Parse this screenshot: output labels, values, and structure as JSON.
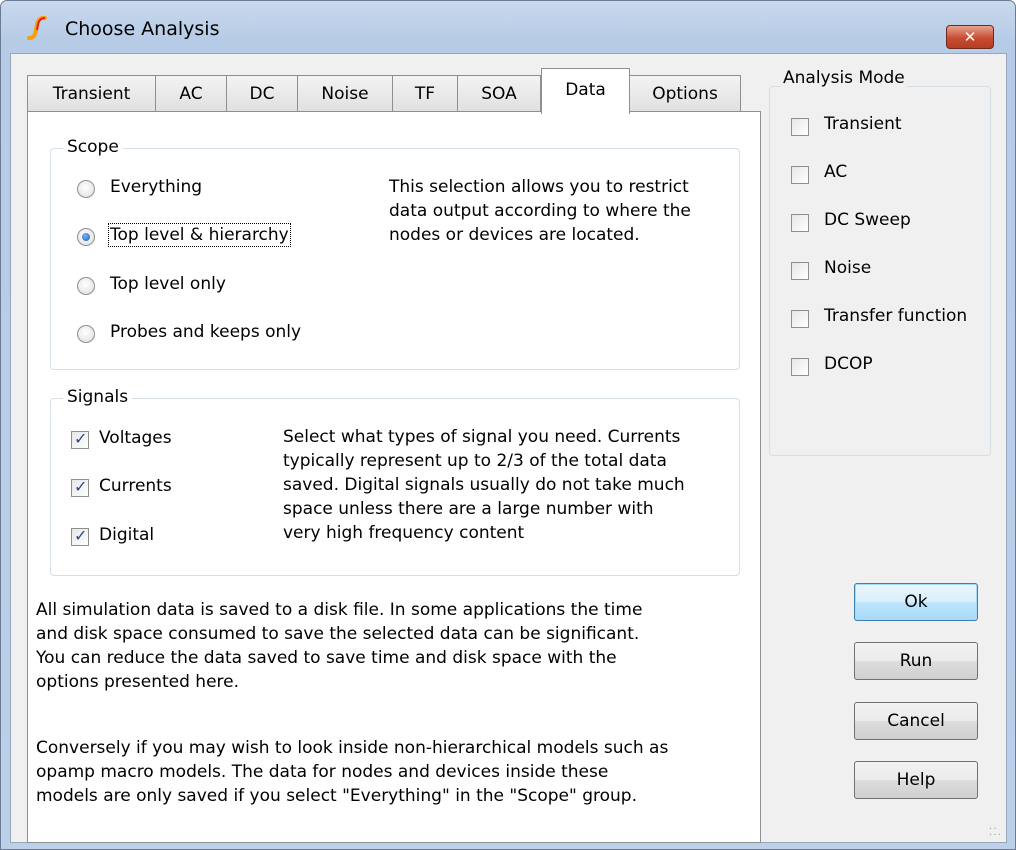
{
  "window": {
    "title": "Choose Analysis",
    "close_glyph": "✕",
    "icon": "simetrix-logo-icon"
  },
  "tabs": [
    {
      "label": "Transient",
      "active": false
    },
    {
      "label": "AC",
      "active": false
    },
    {
      "label": "DC",
      "active": false
    },
    {
      "label": "Noise",
      "active": false
    },
    {
      "label": "TF",
      "active": false
    },
    {
      "label": "SOA",
      "active": false
    },
    {
      "label": "Data",
      "active": true
    },
    {
      "label": "Options",
      "active": false
    }
  ],
  "scope": {
    "title": "Scope",
    "options": [
      {
        "label": "Everything",
        "checked": false
      },
      {
        "label": "Top level & hierarchy",
        "checked": true
      },
      {
        "label": "Top level only",
        "checked": false
      },
      {
        "label": "Probes and keeps only",
        "checked": false
      }
    ],
    "description": [
      "This selection allows you to restrict",
      "data output according to where the",
      "nodes or devices are located."
    ]
  },
  "signals": {
    "title": "Signals",
    "options": [
      {
        "label": "Voltages",
        "checked": true
      },
      {
        "label": "Currents",
        "checked": true
      },
      {
        "label": "Digital",
        "checked": true
      }
    ],
    "description": [
      "Select what types of signal you need. Currents",
      "typically represent up to 2/3 of the total data",
      "saved. Digital signals usually do not take much",
      "space unless there are a large number with",
      "very high frequency content"
    ]
  },
  "info": {
    "para1": [
      "All simulation data is saved to a disk file. In some applications the time",
      "and disk space consumed to save the selected data can be significant.",
      "You can reduce the data saved to save time and disk space with the",
      "options presented here."
    ],
    "para2": [
      "Conversely if you may wish to look inside non-hierarchical models such as",
      "opamp macro models. The data for nodes and devices inside these",
      "models are only saved if you select \"Everything\" in the \"Scope\" group."
    ]
  },
  "analysis_mode": {
    "title": "Analysis Mode",
    "items": [
      {
        "label": "Transient",
        "checked": false
      },
      {
        "label": "AC",
        "checked": false
      },
      {
        "label": "DC Sweep",
        "checked": false
      },
      {
        "label": "Noise",
        "checked": false
      },
      {
        "label": "Transfer function",
        "checked": false
      },
      {
        "label": "DCOP",
        "checked": false
      }
    ]
  },
  "buttons": {
    "ok": "Ok",
    "run": "Run",
    "cancel": "Cancel",
    "help": "Help"
  },
  "colors": {
    "accent": "#3c7fb1",
    "close_button": "#c74d33"
  }
}
